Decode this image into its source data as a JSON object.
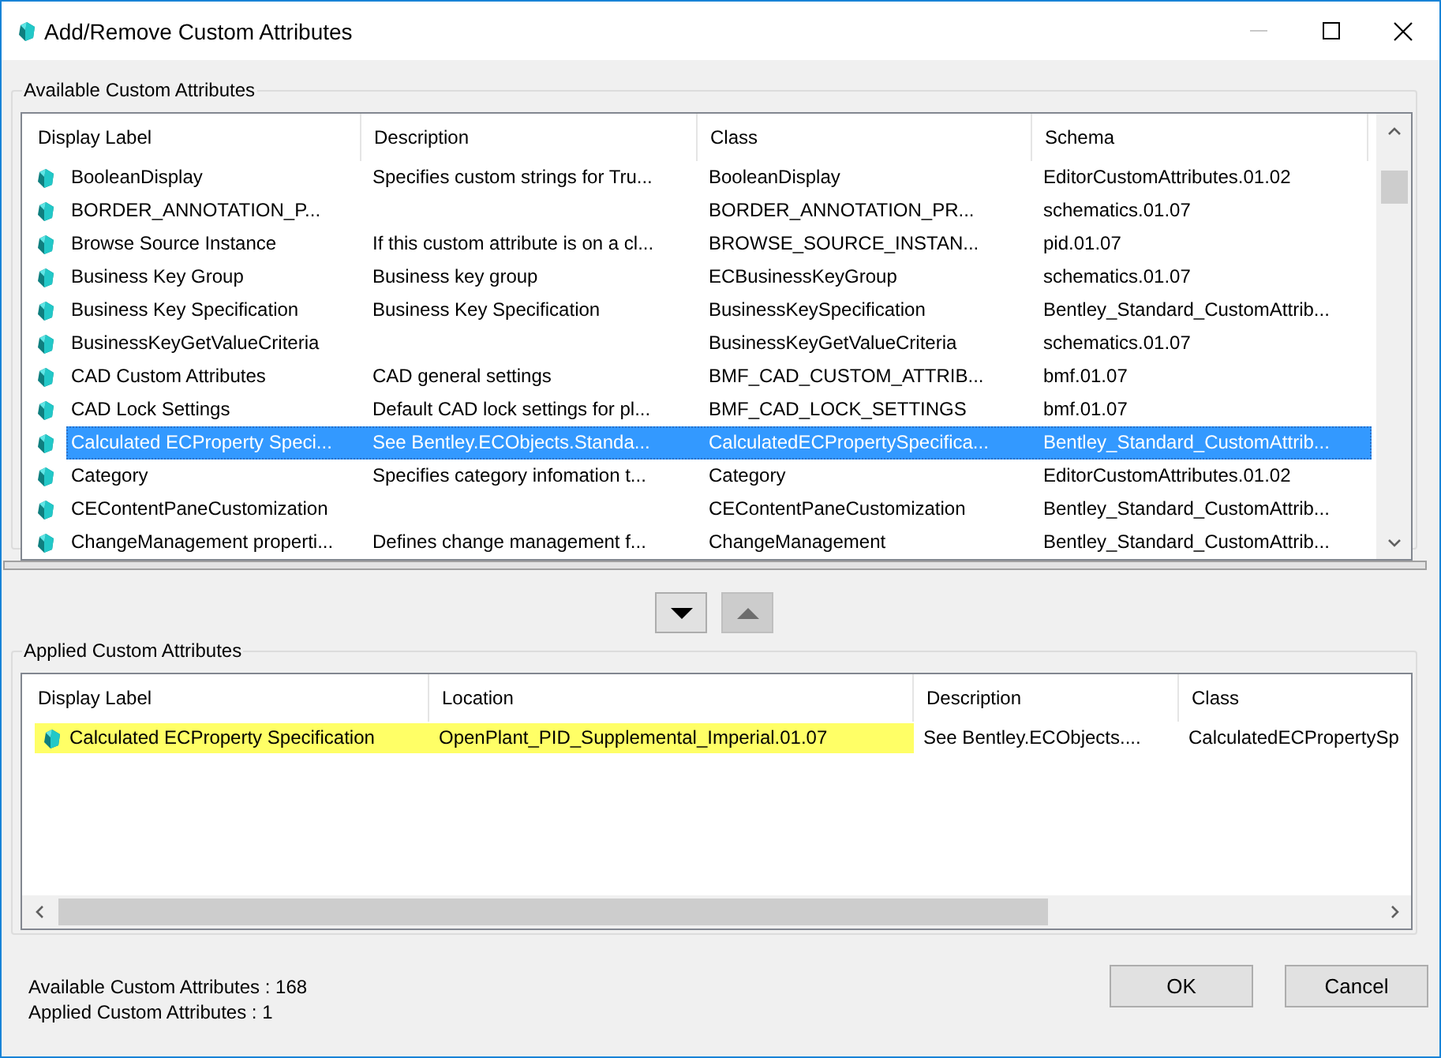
{
  "window": {
    "title": "Add/Remove Custom Attributes"
  },
  "available": {
    "label": "Available Custom Attributes",
    "columns": [
      "Display Label",
      "Description",
      "Class",
      "Schema"
    ],
    "rows": [
      {
        "cells": [
          "BooleanDisplay",
          "Specifies custom strings for Tru...",
          "BooleanDisplay",
          "EditorCustomAttributes.01.02"
        ],
        "selected": false
      },
      {
        "cells": [
          "BORDER_ANNOTATION_P...",
          "",
          "BORDER_ANNOTATION_PR...",
          "schematics.01.07"
        ],
        "selected": false
      },
      {
        "cells": [
          "Browse Source Instance",
          "If this custom attribute is on a cl...",
          "BROWSE_SOURCE_INSTAN...",
          "pid.01.07"
        ],
        "selected": false
      },
      {
        "cells": [
          "Business Key Group",
          "Business key group",
          "ECBusinessKeyGroup",
          "schematics.01.07"
        ],
        "selected": false
      },
      {
        "cells": [
          "Business Key Specification",
          "Business Key Specification",
          "BusinessKeySpecification",
          "Bentley_Standard_CustomAttrib..."
        ],
        "selected": false
      },
      {
        "cells": [
          "BusinessKeyGetValueCriteria",
          "",
          "BusinessKeyGetValueCriteria",
          "schematics.01.07"
        ],
        "selected": false
      },
      {
        "cells": [
          "CAD Custom Attributes",
          "CAD general settings",
          "BMF_CAD_CUSTOM_ATTRIB...",
          "bmf.01.07"
        ],
        "selected": false
      },
      {
        "cells": [
          "CAD Lock Settings",
          "Default CAD lock settings for pl...",
          "BMF_CAD_LOCK_SETTINGS",
          "bmf.01.07"
        ],
        "selected": false
      },
      {
        "cells": [
          "Calculated ECProperty Speci...",
          "See Bentley.ECObjects.Standa...",
          "CalculatedECPropertySpecifica...",
          "Bentley_Standard_CustomAttrib..."
        ],
        "selected": true
      },
      {
        "cells": [
          "Category",
          "Specifies category infomation t...",
          "Category",
          "EditorCustomAttributes.01.02"
        ],
        "selected": false
      },
      {
        "cells": [
          "CEContentPaneCustomization",
          "",
          "CEContentPaneCustomization",
          "Bentley_Standard_CustomAttrib..."
        ],
        "selected": false
      },
      {
        "cells": [
          "ChangeManagement properti...",
          "Defines change management f...",
          "ChangeManagement",
          "Bentley_Standard_CustomAttrib..."
        ],
        "selected": false
      }
    ]
  },
  "move_buttons": [
    {
      "kind": "down",
      "disabled": false
    },
    {
      "kind": "up",
      "disabled": true
    }
  ],
  "applied": {
    "label": "Applied Custom Attributes",
    "columns": [
      "Display Label",
      "Location",
      "Description",
      "Class"
    ],
    "rows": [
      {
        "cells": [
          {
            "text": "Calculated ECProperty Specification",
            "highlighted": true
          },
          {
            "text": "OpenPlant_PID_Supplemental_Imperial.01.07",
            "highlighted": true
          },
          {
            "text": "See Bentley.ECObjects....",
            "highlighted": false
          },
          {
            "text": "CalculatedECPropertySp",
            "highlighted": false
          }
        ]
      }
    ]
  },
  "status": [
    "Available Custom Attributes : 168",
    "Applied Custom Attributes : 1"
  ],
  "buttons": [
    "OK",
    "Cancel"
  ]
}
